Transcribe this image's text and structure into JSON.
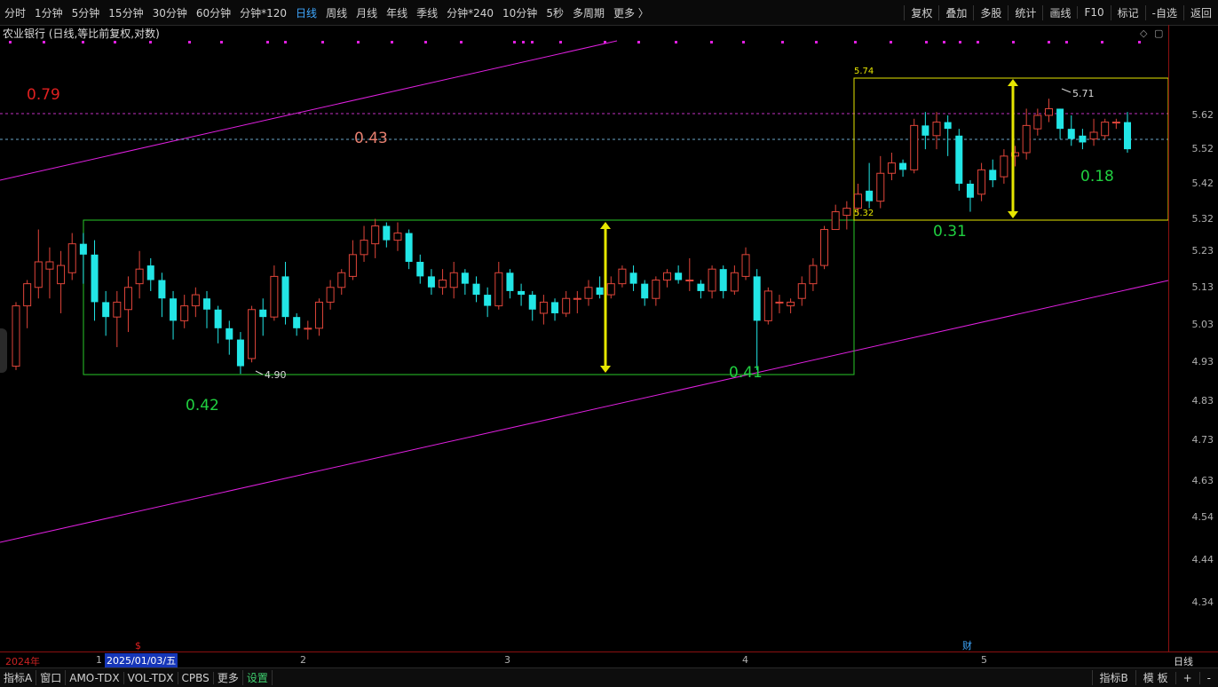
{
  "toolbar": {
    "periods": [
      {
        "label": "分时",
        "active": false
      },
      {
        "label": "1分钟",
        "active": false
      },
      {
        "label": "5分钟",
        "active": false
      },
      {
        "label": "15分钟",
        "active": false
      },
      {
        "label": "30分钟",
        "active": false
      },
      {
        "label": "60分钟",
        "active": false
      },
      {
        "label": "分钟*120",
        "active": false
      },
      {
        "label": "日线",
        "active": true
      },
      {
        "label": "周线",
        "active": false
      },
      {
        "label": "月线",
        "active": false
      },
      {
        "label": "年线",
        "active": false
      },
      {
        "label": "季线",
        "active": false
      },
      {
        "label": "分钟*240",
        "active": false
      },
      {
        "label": "10分钟",
        "active": false
      },
      {
        "label": "5秒",
        "active": false
      },
      {
        "label": "多周期",
        "active": false
      },
      {
        "label": "更多 〉",
        "active": false
      }
    ],
    "right_actions": [
      "复权",
      "叠加",
      "多股",
      "统计",
      "画线",
      "F10",
      "标记",
      "-自选",
      "返回"
    ]
  },
  "chart_title": "农业银行 (日线,等比前复权,对数)",
  "colors": {
    "up": "#e0453a",
    "down": "#22e6e6",
    "annotation_red": "#e02020",
    "annotation_green": "#20d040",
    "box_green": "#28c828",
    "box_yellow": "#e6e600",
    "trend": "#e020e0"
  },
  "price_axis_ticks": [
    "5.62",
    "5.52",
    "5.42",
    "5.32",
    "5.23",
    "5.13",
    "5.03",
    "4.93",
    "4.83",
    "4.73",
    "4.63",
    "4.54",
    "4.44",
    "4.34"
  ],
  "date_axis": {
    "labels": [
      {
        "text": "2024年",
        "cls": "y2024"
      },
      {
        "text": "1",
        "cls": ""
      },
      {
        "text": "2",
        "cls": ""
      },
      {
        "text": "3",
        "cls": ""
      },
      {
        "text": "4",
        "cls": ""
      },
      {
        "text": "5",
        "cls": ""
      }
    ],
    "selected_date": "2025/01/03/五",
    "period_button": "日线"
  },
  "markers": {
    "dividend": "$",
    "earnings": "财"
  },
  "annotations": {
    "red_1": "0.79",
    "red_2": "0.43",
    "green_1": "0.42",
    "green_2": "0.41",
    "green_3": "0.31",
    "green_4": "0.18",
    "box_top_label": "5.74",
    "box_mid_label": "5.32",
    "low_label": "4.90",
    "high_label": "5.71"
  },
  "bottom_bar": {
    "tabs": [
      "指标A",
      "窗口",
      "AMO-TDX",
      "VOL-TDX",
      "CPBS",
      "更多",
      "设置"
    ],
    "right": [
      "指标B",
      "模 板",
      "+",
      "-"
    ]
  },
  "chart_data": {
    "type": "candlestick",
    "title": "农业银行 (日线,等比前复权,对数)",
    "scale": "log",
    "ylim": [
      4.3,
      5.8
    ],
    "candles": [
      [
        4.92,
        5.08,
        4.91,
        5.09
      ],
      [
        5.08,
        5.14,
        5.02,
        5.15
      ],
      [
        5.13,
        5.2,
        5.1,
        5.29
      ],
      [
        5.18,
        5.2,
        5.1,
        5.24
      ],
      [
        5.14,
        5.19,
        5.06,
        5.23
      ],
      [
        5.17,
        5.25,
        5.15,
        5.28
      ],
      [
        5.25,
        5.22,
        5.14,
        5.28
      ],
      [
        5.22,
        5.09,
        5.04,
        5.26
      ],
      [
        5.09,
        5.05,
        5.0,
        5.12
      ],
      [
        5.05,
        5.09,
        4.97,
        5.12
      ],
      [
        5.07,
        5.13,
        5.01,
        5.16
      ],
      [
        5.14,
        5.18,
        5.1,
        5.23
      ],
      [
        5.19,
        5.15,
        5.12,
        5.21
      ],
      [
        5.15,
        5.1,
        5.05,
        5.17
      ],
      [
        5.1,
        5.04,
        4.99,
        5.12
      ],
      [
        5.04,
        5.08,
        5.02,
        5.11
      ],
      [
        5.08,
        5.11,
        5.05,
        5.13
      ],
      [
        5.1,
        5.07,
        5.02,
        5.12
      ],
      [
        5.07,
        5.02,
        4.98,
        5.08
      ],
      [
        5.02,
        4.99,
        4.95,
        5.04
      ],
      [
        4.99,
        4.92,
        4.9,
        5.01
      ],
      [
        4.94,
        5.07,
        4.93,
        5.08
      ],
      [
        5.07,
        5.05,
        5.0,
        5.1
      ],
      [
        5.05,
        5.16,
        5.04,
        5.19
      ],
      [
        5.16,
        5.05,
        5.03,
        5.2
      ],
      [
        5.05,
        5.02,
        5.0,
        5.06
      ],
      [
        5.02,
        5.02,
        4.99,
        5.04
      ],
      [
        5.02,
        5.09,
        5.0,
        5.1
      ],
      [
        5.09,
        5.13,
        5.07,
        5.15
      ],
      [
        5.13,
        5.17,
        5.11,
        5.18
      ],
      [
        5.16,
        5.22,
        5.15,
        5.26
      ],
      [
        5.22,
        5.26,
        5.2,
        5.3
      ],
      [
        5.25,
        5.3,
        5.21,
        5.32
      ],
      [
        5.3,
        5.26,
        5.24,
        5.31
      ],
      [
        5.26,
        5.28,
        5.23,
        5.31
      ],
      [
        5.28,
        5.2,
        5.18,
        5.29
      ],
      [
        5.2,
        5.16,
        5.14,
        5.22
      ],
      [
        5.16,
        5.13,
        5.11,
        5.18
      ],
      [
        5.13,
        5.15,
        5.11,
        5.18
      ],
      [
        5.13,
        5.17,
        5.1,
        5.2
      ],
      [
        5.17,
        5.14,
        5.11,
        5.18
      ],
      [
        5.14,
        5.11,
        5.09,
        5.16
      ],
      [
        5.11,
        5.08,
        5.05,
        5.13
      ],
      [
        5.08,
        5.17,
        5.07,
        5.2
      ],
      [
        5.17,
        5.12,
        5.1,
        5.18
      ],
      [
        5.12,
        5.11,
        5.08,
        5.14
      ],
      [
        5.11,
        5.07,
        5.04,
        5.12
      ],
      [
        5.06,
        5.09,
        5.03,
        5.11
      ],
      [
        5.09,
        5.06,
        5.04,
        5.1
      ],
      [
        5.06,
        5.1,
        5.05,
        5.12
      ],
      [
        5.1,
        5.1,
        5.06,
        5.12
      ],
      [
        5.1,
        5.13,
        5.08,
        5.15
      ],
      [
        5.13,
        5.11,
        5.1,
        5.16
      ],
      [
        5.11,
        5.14,
        5.1,
        5.16
      ],
      [
        5.14,
        5.18,
        5.13,
        5.19
      ],
      [
        5.17,
        5.14,
        5.12,
        5.19
      ],
      [
        5.14,
        5.1,
        5.08,
        5.15
      ],
      [
        5.1,
        5.15,
        5.08,
        5.16
      ],
      [
        5.15,
        5.17,
        5.13,
        5.18
      ],
      [
        5.17,
        5.15,
        5.14,
        5.19
      ],
      [
        5.15,
        5.15,
        5.12,
        5.21
      ],
      [
        5.14,
        5.12,
        5.1,
        5.15
      ],
      [
        5.12,
        5.18,
        5.1,
        5.19
      ],
      [
        5.18,
        5.12,
        5.1,
        5.19
      ],
      [
        5.12,
        5.17,
        5.11,
        5.19
      ],
      [
        5.16,
        5.22,
        5.15,
        5.24
      ],
      [
        5.16,
        5.04,
        4.91,
        5.18
      ],
      [
        5.04,
        5.12,
        5.03,
        5.13
      ],
      [
        5.09,
        5.09,
        5.06,
        5.11
      ],
      [
        5.08,
        5.09,
        5.06,
        5.1
      ],
      [
        5.1,
        5.14,
        5.08,
        5.16
      ],
      [
        5.14,
        5.19,
        5.12,
        5.21
      ],
      [
        5.19,
        5.29,
        5.18,
        5.3
      ],
      [
        5.29,
        5.34,
        5.29,
        5.36
      ],
      [
        5.33,
        5.35,
        5.29,
        5.37
      ],
      [
        5.35,
        5.39,
        5.33,
        5.42
      ],
      [
        5.4,
        5.37,
        5.35,
        5.48
      ],
      [
        5.37,
        5.45,
        5.35,
        5.5
      ],
      [
        5.45,
        5.48,
        5.43,
        5.51
      ],
      [
        5.48,
        5.46,
        5.44,
        5.49
      ],
      [
        5.46,
        5.59,
        5.45,
        5.61
      ],
      [
        5.59,
        5.56,
        5.52,
        5.63
      ],
      [
        5.56,
        5.6,
        5.52,
        5.63
      ],
      [
        5.6,
        5.58,
        5.5,
        5.62
      ],
      [
        5.56,
        5.42,
        5.4,
        5.58
      ],
      [
        5.42,
        5.38,
        5.34,
        5.43
      ],
      [
        5.39,
        5.46,
        5.37,
        5.48
      ],
      [
        5.46,
        5.43,
        5.41,
        5.49
      ],
      [
        5.44,
        5.5,
        5.42,
        5.52
      ],
      [
        5.5,
        5.51,
        5.47,
        5.53
      ],
      [
        5.51,
        5.59,
        5.49,
        5.64
      ],
      [
        5.58,
        5.62,
        5.56,
        5.64
      ],
      [
        5.62,
        5.64,
        5.6,
        5.67
      ],
      [
        5.64,
        5.58,
        5.55,
        5.64
      ],
      [
        5.58,
        5.55,
        5.53,
        5.62
      ],
      [
        5.56,
        5.54,
        5.52,
        5.58
      ],
      [
        5.55,
        5.57,
        5.53,
        5.61
      ],
      [
        5.56,
        5.6,
        5.55,
        5.61
      ],
      [
        5.6,
        5.6,
        5.58,
        5.61
      ],
      [
        5.6,
        5.52,
        5.51,
        5.63
      ]
    ],
    "boxes": [
      {
        "color": "green",
        "top": 5.32,
        "bottom": 4.9
      },
      {
        "color": "yellow",
        "top": 5.74,
        "bottom": 5.32
      }
    ]
  }
}
